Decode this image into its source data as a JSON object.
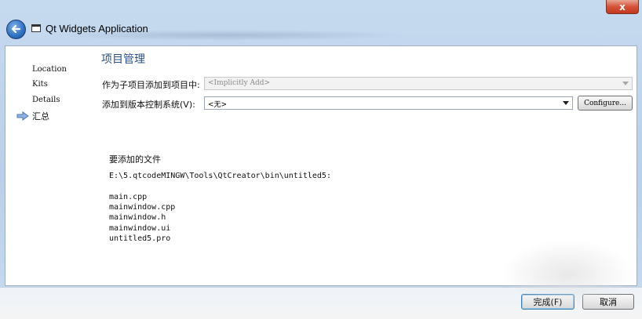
{
  "window": {
    "title": "Qt Widgets Application",
    "close_label": "x"
  },
  "sidebar": {
    "items": [
      {
        "label": "Location"
      },
      {
        "label": "Kits"
      },
      {
        "label": "Details"
      },
      {
        "label": "汇总",
        "current": true
      }
    ]
  },
  "main": {
    "section_title": "项目管理",
    "add_subproject_label": "作为子项目添加到项目中:",
    "add_subproject_value": "<Implicitly Add>",
    "vcs_label": "添加到版本控制系统(V):",
    "vcs_value": "<无>",
    "configure_label": "Configure...",
    "files_heading": "要添加的文件",
    "files_path": "E:\\5.qtcodeMINGW\\Tools\\QtCreator\\bin\\untitled5:",
    "files": [
      "main.cpp",
      "mainwindow.cpp",
      "mainwindow.h",
      "mainwindow.ui",
      "untitled5.pro"
    ]
  },
  "footer": {
    "finish_label": "完成(F)",
    "cancel_label": "取消"
  },
  "colors": {
    "accent": "#2a4f8a",
    "frame": "#c6daef",
    "close_button": "#d5533a"
  }
}
